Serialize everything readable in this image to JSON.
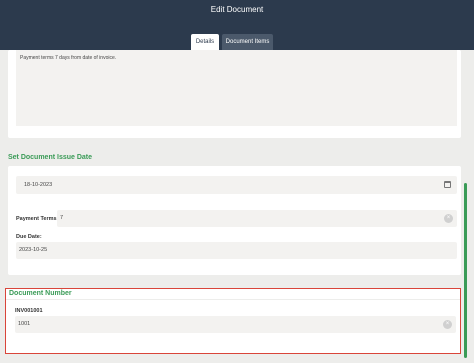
{
  "header": {
    "title": "Edit Document",
    "tabs": [
      {
        "label": "Details",
        "active": true
      },
      {
        "label": "Document Items",
        "active": false
      }
    ]
  },
  "notes": {
    "value": "Payment terms 7 days from date of invoice."
  },
  "issue_date_section": {
    "title": "Set Document Issue Date",
    "date_value": "18-10-2023",
    "payment_terms_label": "Payment Terms:",
    "payment_terms_value": "7",
    "due_date_label": "Due Date:",
    "due_date_value": "2023-10-25"
  },
  "document_number_section": {
    "title": "Document Number",
    "label": "INV001001",
    "value": "1001"
  },
  "colors": {
    "header_bg": "#2c3a4d",
    "accent_green": "#3a9b57",
    "highlight_red": "#d9453a"
  },
  "icons": {
    "calendar": "calendar-icon",
    "clear": "clear-icon"
  }
}
